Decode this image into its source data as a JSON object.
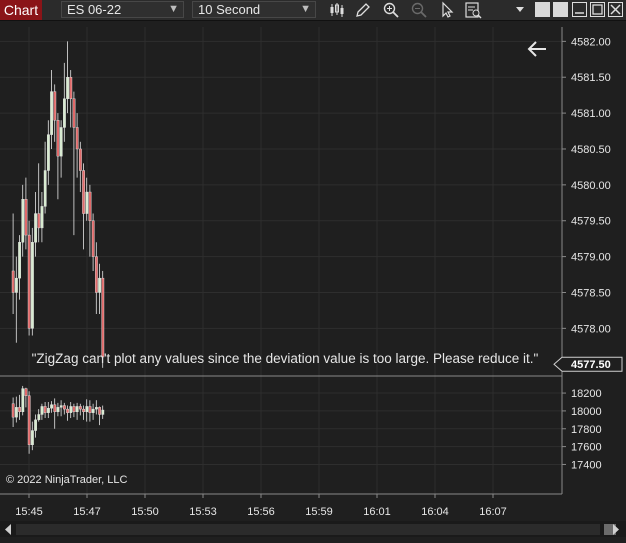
{
  "toolbar": {
    "chart_tab": "Chart",
    "instrument": "ES 06-22",
    "interval": "10 Second"
  },
  "notice": "\"ZigZag can't plot any values since the deviation value is too large. Please reduce it.\"",
  "copyright": "© 2022 NinjaTrader, LLC",
  "colors": {
    "up_candle": "#d8ecd0",
    "down_candle": "#e06a6a",
    "background": "#1f1f1f",
    "grid": "#2e2e2e",
    "chart_tab": "#8a1418"
  },
  "chart_data": [
    {
      "type": "candlestick",
      "panel": "price",
      "ylim": [
        4577.35,
        4582.2
      ],
      "y_ticks": [
        4578.0,
        4578.5,
        4579.0,
        4579.5,
        4580.0,
        4580.5,
        4581.0,
        4581.5,
        4582.0
      ],
      "y_tick_labels": [
        "4578.00",
        "4578.50",
        "4579.00",
        "4579.50",
        "4580.00",
        "4580.50",
        "4581.00",
        "4581.50",
        "4582.00"
      ],
      "last_price_label": "4577.50",
      "last_price": 4577.5,
      "candles": [
        [
          4578.8,
          4578.5,
          4579.6,
          4578.2
        ],
        [
          4578.5,
          4578.7,
          4579.0,
          4577.8
        ],
        [
          4578.7,
          4579.2,
          4579.3,
          4578.4
        ],
        [
          4579.2,
          4579.8,
          4580.0,
          4579.0
        ],
        [
          4579.8,
          4579.3,
          4580.1,
          4579.1
        ],
        [
          4579.3,
          4578.0,
          4579.5,
          4577.9
        ],
        [
          4578.0,
          4579.2,
          4579.4,
          4577.9
        ],
        [
          4579.2,
          4579.6,
          4579.9,
          4579.0
        ],
        [
          4579.6,
          4579.4,
          4580.3,
          4579.2
        ],
        [
          4579.4,
          4579.7,
          4579.9,
          4579.2
        ],
        [
          4579.7,
          4580.2,
          4580.6,
          4579.6
        ],
        [
          4580.2,
          4580.7,
          4580.9,
          4580.0
        ],
        [
          4580.7,
          4581.3,
          4581.6,
          4580.5
        ],
        [
          4581.3,
          4580.9,
          4581.4,
          4580.6
        ],
        [
          4580.9,
          4580.4,
          4581.0,
          4579.8
        ],
        [
          4580.4,
          4580.8,
          4580.9,
          4580.1
        ],
        [
          4580.8,
          4581.2,
          4581.7,
          4580.6
        ],
        [
          4581.2,
          4581.5,
          4582.0,
          4581.0
        ],
        [
          4581.5,
          4581.2,
          4581.6,
          4580.8
        ],
        [
          4581.2,
          4580.8,
          4581.3,
          4579.3
        ],
        [
          4580.8,
          4580.5,
          4581.0,
          4580.1
        ],
        [
          4580.5,
          4580.2,
          4580.6,
          4579.9
        ],
        [
          4580.2,
          4579.6,
          4580.3,
          4579.1
        ],
        [
          4579.6,
          4579.9,
          4580.1,
          4579.5
        ],
        [
          4579.9,
          4579.5,
          4580.0,
          4579.0
        ],
        [
          4579.5,
          4579.0,
          4579.6,
          4578.8
        ],
        [
          4579.0,
          4578.5,
          4579.2,
          4578.2
        ],
        [
          4578.5,
          4578.7,
          4578.9,
          4578.2
        ],
        [
          4578.7,
          4577.6,
          4578.8,
          4577.45
        ]
      ]
    },
    {
      "type": "bar",
      "panel": "lower",
      "ylim": [
        17080,
        18380
      ],
      "y_ticks": [
        17400,
        17600,
        17800,
        18000,
        18200
      ],
      "y_tick_labels": [
        "17400",
        "17600",
        "17800",
        "18000",
        "18200"
      ],
      "values": [
        [
          18080,
          17930,
          18150,
          17820
        ],
        [
          17930,
          18040,
          18160,
          17870
        ],
        [
          18040,
          17990,
          18180,
          17900
        ],
        [
          17990,
          18250,
          18280,
          17950
        ],
        [
          18250,
          18170,
          18260,
          18040
        ],
        [
          18170,
          17620,
          18220,
          17520
        ],
        [
          17620,
          17780,
          17880,
          17560
        ],
        [
          17780,
          17900,
          17960,
          17700
        ],
        [
          17900,
          17960,
          18020,
          17880
        ],
        [
          17960,
          18050,
          18080,
          17900
        ],
        [
          18050,
          17980,
          18100,
          17920
        ],
        [
          17980,
          18030,
          18100,
          17920
        ],
        [
          18030,
          18070,
          18110,
          17980
        ],
        [
          18070,
          17990,
          18140,
          17800
        ],
        [
          17990,
          18040,
          18090,
          17940
        ],
        [
          18040,
          18060,
          18120,
          17940
        ],
        [
          18060,
          18020,
          18090,
          17960
        ],
        [
          18020,
          17980,
          18060,
          17890
        ],
        [
          17980,
          18050,
          18100,
          17920
        ],
        [
          18050,
          17990,
          18080,
          17930
        ],
        [
          17990,
          18050,
          18090,
          17900
        ],
        [
          18050,
          18020,
          18080,
          17950
        ],
        [
          18020,
          17990,
          18060,
          17900
        ],
        [
          17990,
          18050,
          18130,
          17880
        ],
        [
          18050,
          17980,
          18120,
          17880
        ],
        [
          17980,
          18020,
          18080,
          17900
        ],
        [
          18020,
          18040,
          18120,
          17960
        ],
        [
          18040,
          17960,
          18050,
          17840
        ],
        [
          17960,
          18010,
          18060,
          17910
        ]
      ]
    },
    {
      "type": "axis",
      "panel": "time",
      "x_tick_labels": [
        "15:45",
        "15:47",
        "15:50",
        "15:53",
        "15:56",
        "15:59",
        "16:01",
        "16:04",
        "16:07"
      ]
    }
  ]
}
